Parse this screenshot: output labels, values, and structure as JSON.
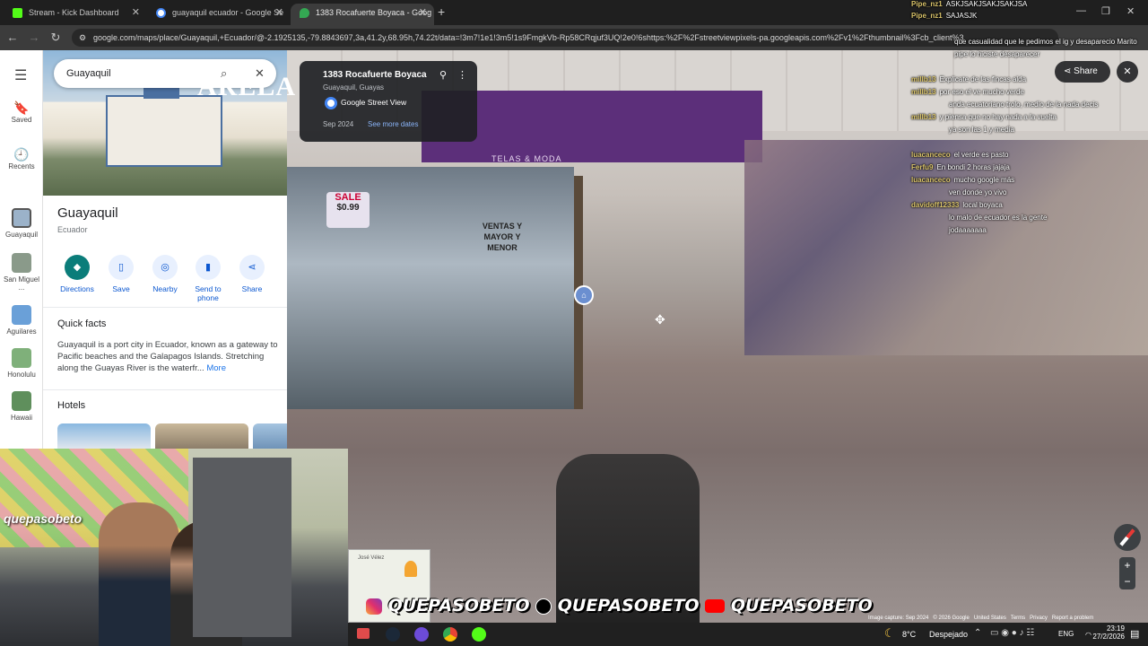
{
  "browser": {
    "tabs": [
      {
        "title": "Stream - Kick Dashboard",
        "color": "#53fc18"
      },
      {
        "title": "guayaquil ecuador - Google Se",
        "color": "#4285f4"
      },
      {
        "title": "1383 Rocafuerte Boyaca - Goog",
        "color": "#34a853"
      }
    ],
    "new_tab": "+",
    "url": "google.com/maps/place/Guayaquil,+Ecuador/@-2.1925135,-79.8843697,3a,41.2y,68.95h,74.22t/data=!3m7!1e1!3m5!1s9FmgkVb-Rp58CRqjuf3UQ!2e0!6shttps:%2F%2Fstreetviewpixels-pa.googleapis.com%2Fv1%2Fthumbnail%3Fcb_client%3"
  },
  "maps": {
    "rail": {
      "menu_icon": "menu-icon",
      "items": [
        {
          "label": "Saved",
          "icon": "bookmark-icon"
        },
        {
          "label": "Recents",
          "icon": "history-icon"
        },
        {
          "label": "Guayaquil"
        },
        {
          "label": "San Miguel ..."
        },
        {
          "label": "Aguilares"
        },
        {
          "label": "Honolulu"
        },
        {
          "label": "Hawaii"
        }
      ]
    },
    "search": {
      "value": "Guayaquil"
    },
    "place": {
      "title": "Guayaquil",
      "subtitle": "Ecuador",
      "actions": [
        "Directions",
        "Save",
        "Nearby",
        "Send to phone",
        "Share"
      ],
      "quick_facts_heading": "Quick facts",
      "quick_facts_text": "Guayaquil is a port city in Ecuador, known as a gateway to Pacific beaches and the Galapagos Islands. Stretching along the Guayas River is the waterfr...",
      "more_label": "More",
      "hotels_heading": "Hotels"
    }
  },
  "streetview": {
    "address": "1383 Rocafuerte Boyaca",
    "locality": "Guayaquil, Guayas",
    "source": "Google Street View",
    "date": "Sep 2024",
    "more_dates": "See more dates",
    "share_label": "Share",
    "store_sign": "ARELA",
    "store_sub": "TELAS & MODA",
    "sale": "SALE",
    "price": "$0.99",
    "ventas": "VENTAS Y MAYOR Y MENOR",
    "footer": [
      "Image capture: Sep 2024",
      "© 2026 Google",
      "United States",
      "Terms",
      "Privacy",
      "Report a problem"
    ],
    "minimap_label": "José Vélez"
  },
  "chat": [
    {
      "user": "Pipe_nz1",
      "msg": "ASKJSAKJSAKJSAKJSA"
    },
    {
      "user": "Pipe_nz1",
      "msg": "SAJASJK"
    },
    {
      "user": "",
      "msg": "que casualidad que le pedimos el ig y desaparecio Marito"
    },
    {
      "user": "",
      "msg": "pipe lo hiciste desaparecer"
    },
    {
      "user": "millb13",
      "msg": "Explicate de las fincas alda"
    },
    {
      "user": "millb13",
      "msg": "por eso el ve mucho verde"
    },
    {
      "user": "",
      "msg": "anda ecuatoriano trolo, medio de la nada decis"
    },
    {
      "user": "millb13",
      "msg": "y piensa que no hay nada a la vuelta"
    },
    {
      "user": "",
      "msg": "ya son las 1 y media"
    },
    {
      "user": "luacanceco",
      "msg": "el verde es pasto"
    },
    {
      "user": "Ferfu9",
      "msg": "En bondi 2 horas jajaja"
    },
    {
      "user": "luacanceco",
      "msg": "mucho google más"
    },
    {
      "user": "",
      "msg": "ven donde yo vivo"
    },
    {
      "user": "davidoff12333",
      "msg": "local boyaca"
    },
    {
      "user": "",
      "msg": "lo malo de ecuador es la gente"
    },
    {
      "user": "",
      "msg": "jodaaaaaaa"
    }
  ],
  "social_handles": [
    "QUEPASOBETO",
    "QUEPASOBETO",
    "QUEPASOBETO"
  ],
  "webcam_text": "quepasobeto",
  "taskbar": {
    "weather_temp": "8°C",
    "weather_desc": "Despejado",
    "lang": "ENG",
    "time": "23:19",
    "date": "27/2/2026"
  }
}
